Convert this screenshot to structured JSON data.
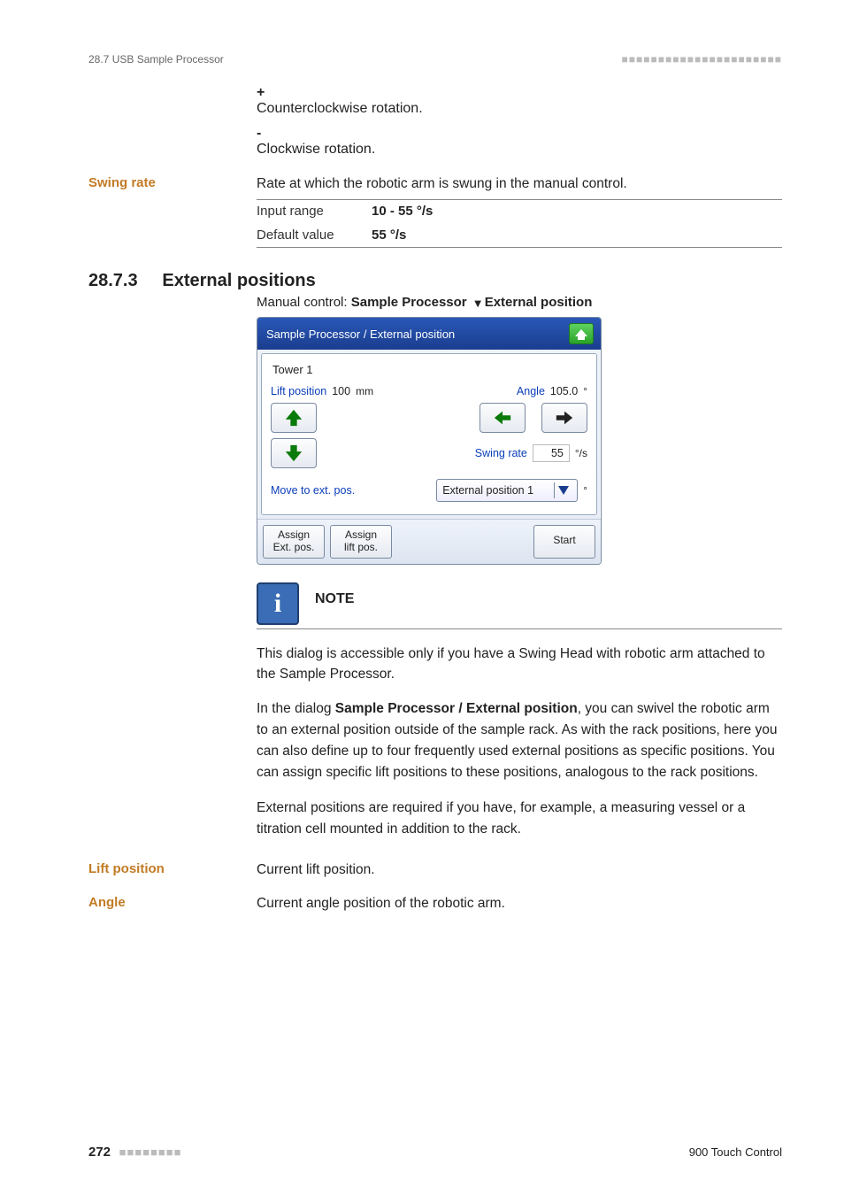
{
  "header": {
    "left": "28.7 USB Sample Processor",
    "dashes": "■■■■■■■■■■■■■■■■■■■■■■"
  },
  "plus": {
    "symbol": "+",
    "text": "Counterclockwise rotation."
  },
  "minus": {
    "symbol": "-",
    "text": "Clockwise rotation."
  },
  "swing_rate": {
    "label": "Swing rate",
    "desc": "Rate at which the robotic arm is swung in the manual control.",
    "input_range_label": "Input range",
    "input_range_value": "10 - 55 °/s",
    "default_label": "Default value",
    "default_value": "55 °/s"
  },
  "section": {
    "num": "28.7.3",
    "title": "External positions",
    "breadcrumb_prefix": "Manual control: ",
    "breadcrumb_a": "Sample Processor",
    "breadcrumb_b": "External position"
  },
  "shot": {
    "title": "Sample Processor / External position",
    "tower": "Tower 1",
    "lift_label": "Lift position",
    "lift_value": "100",
    "lift_unit": "mm",
    "angle_label": "Angle",
    "angle_value": "105.0",
    "angle_unit": "°",
    "swing_label": "Swing rate",
    "swing_value": "55",
    "swing_unit": "°/s",
    "move_label": "Move to ext. pos.",
    "drop_label": "External position 1",
    "drop_unit": "°",
    "foot": {
      "assign_ext_l1": "Assign",
      "assign_ext_l2": "Ext. pos.",
      "assign_lift_l1": "Assign",
      "assign_lift_l2": "lift pos.",
      "start": "Start"
    }
  },
  "note": {
    "title": "NOTE",
    "body": "This dialog is accessible only if you have a Swing Head with robotic arm attached to the Sample Processor."
  },
  "para1_a": "In the dialog ",
  "para1_b": "Sample Processor / External position",
  "para1_c": ", you can swivel the robotic arm to an external position outside of the sample rack. As with the rack positions, here you can also define up to four frequently used external positions as specific positions. You can assign specific lift positions to these positions, analogous to the rack positions.",
  "para2": "External positions are required if you have, for example, a measuring vessel or a titration cell mounted in addition to the rack.",
  "lift_pos": {
    "label": "Lift position",
    "text": "Current lift position."
  },
  "angle": {
    "label": "Angle",
    "text": "Current angle position of the robotic arm."
  },
  "footer": {
    "page": "272",
    "dashes": "■■■■■■■■",
    "right": "900 Touch Control"
  }
}
